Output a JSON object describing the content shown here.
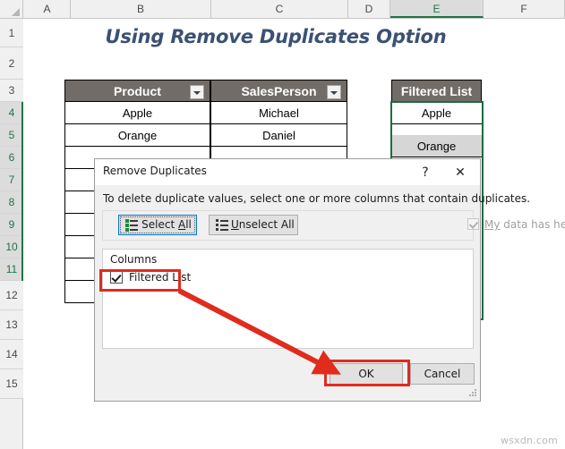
{
  "sheet": {
    "title": "Using Remove Duplicates Option",
    "column_headers": [
      "A",
      "B",
      "C",
      "D",
      "E",
      "F"
    ],
    "selected_column": "E",
    "row_headers": [
      "1",
      "2",
      "3",
      "4",
      "5",
      "6",
      "7",
      "8",
      "9",
      "10",
      "11",
      "12",
      "13",
      "14",
      "15"
    ],
    "selected_rows": [
      "4",
      "5",
      "6",
      "7",
      "8",
      "9",
      "10",
      "11"
    ],
    "corner_icon": "select-all-triangle-icon"
  },
  "data_table": {
    "headers": [
      {
        "label": "Product",
        "filter_icon": "filter-dropdown-icon"
      },
      {
        "label": "SalesPerson",
        "filter_icon": "filter-dropdown-icon"
      }
    ],
    "rows": [
      {
        "product": "Apple",
        "salesperson": "Michael"
      },
      {
        "product": "Orange",
        "salesperson": "Daniel"
      }
    ]
  },
  "filtered_list": {
    "header": "Filtered List",
    "values": [
      "Apple",
      "Orange"
    ]
  },
  "dialog": {
    "title": "Remove Duplicates",
    "help_icon": "question-mark-icon",
    "close_icon": "close-x-icon",
    "instruction": "To delete duplicate values, select one or more columns that contain duplicates.",
    "select_all_label": "Select All",
    "select_all_accel": "A",
    "unselect_all_label": "Unselect All",
    "unselect_all_accel": "U",
    "headers_checkbox_label": "My data has headers",
    "headers_checkbox_accel": "My",
    "headers_checkbox_checked": true,
    "headers_checkbox_enabled": false,
    "columns_group_label": "Columns",
    "column_items": [
      {
        "label": "Filtered List",
        "checked": true
      }
    ],
    "ok_label": "OK",
    "cancel_label": "Cancel",
    "resize_grip_icon": "resize-grip-icon"
  },
  "annotations": {
    "highlight_column_item": "red-rectangle",
    "highlight_ok_button": "red-rectangle",
    "arrow": "red-arrow",
    "accent_red": "#e02b1d",
    "accent_green": "#217346",
    "header_fill": "#716c68",
    "title_color": "#3b5172"
  },
  "watermark": {
    "text": "wsxdn.com"
  }
}
